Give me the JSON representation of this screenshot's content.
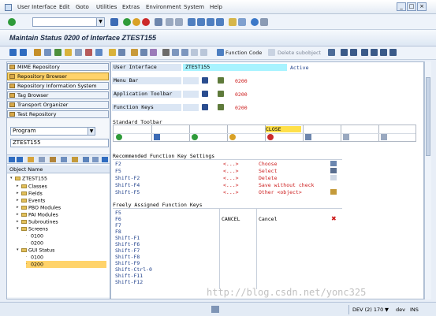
{
  "menu": {
    "items": [
      "User Interface",
      "Edit",
      "Goto",
      "Utilities",
      "Extras",
      "Environment",
      "System",
      "Help"
    ]
  },
  "title": "Maintain Status 0200 of Interface ZTEST155",
  "toolbar2": {
    "function_code": "Function Code",
    "delete_subobject": "Delete subobject"
  },
  "nav": {
    "buttons": [
      "MIME Repository",
      "Repository Browser",
      "Repository Information System",
      "Tag Browser",
      "Transport Organizer",
      "Test Repository"
    ],
    "selected_index": 1
  },
  "object": {
    "type": "Program",
    "name": "ZTEST155"
  },
  "tree": {
    "header": "Object Name",
    "nodes": [
      {
        "label": "ZTEST155",
        "depth": 0,
        "expanded": true
      },
      {
        "label": "Classes",
        "depth": 1
      },
      {
        "label": "Fields",
        "depth": 1
      },
      {
        "label": "Events",
        "depth": 1
      },
      {
        "label": "PBO Modules",
        "depth": 1
      },
      {
        "label": "PAI Modules",
        "depth": 1
      },
      {
        "label": "Subroutines",
        "depth": 1
      },
      {
        "label": "Screens",
        "depth": 1,
        "expanded": true
      },
      {
        "label": "0100",
        "depth": 2
      },
      {
        "label": "0200",
        "depth": 2
      },
      {
        "label": "GUI Status",
        "depth": 1,
        "expanded": true
      },
      {
        "label": "0100",
        "depth": 2
      },
      {
        "label": "0200",
        "depth": 2,
        "selected": true
      }
    ]
  },
  "header_fields": {
    "user_interface_label": "User Interface",
    "user_interface_value": "ZTEST155",
    "status": "Active",
    "menu_bar_label": "Menu Bar",
    "menu_bar_value": "0200",
    "app_toolbar_label": "Application Toolbar",
    "app_toolbar_value": "0200",
    "function_keys_label": "Function Keys",
    "function_keys_value": "0200"
  },
  "standard_toolbar": {
    "title": "Standard Toolbar",
    "close_code": "CLOSE"
  },
  "recommended": {
    "title": "Recommended Function Key Settings",
    "rows": [
      {
        "key": "F2",
        "code": "<...>",
        "text": "Choose"
      },
      {
        "key": "F5",
        "code": "<...>",
        "text": "Select"
      },
      {
        "key": "Shift-F2",
        "code": "<...>",
        "text": "Delete"
      },
      {
        "key": "Shift-F4",
        "code": "<...>",
        "text": "Save without check"
      },
      {
        "key": "Shift-F5",
        "code": "<...>",
        "text": "Other <object>"
      }
    ]
  },
  "freely": {
    "title": "Freely Assigned Function Keys",
    "rows": [
      {
        "key": "F6",
        "code": "CANCEL",
        "text": "Cancel"
      },
      {
        "key": "F7",
        "code": "",
        "text": ""
      },
      {
        "key": "F8",
        "code": "",
        "text": ""
      },
      {
        "key": "Shift-F1",
        "code": "",
        "text": ""
      },
      {
        "key": "Shift-F6",
        "code": "",
        "text": ""
      },
      {
        "key": "Shift-F7",
        "code": "",
        "text": ""
      },
      {
        "key": "Shift-F8",
        "code": "",
        "text": ""
      },
      {
        "key": "Shift-F9",
        "code": "",
        "text": ""
      },
      {
        "key": "Shift-Ctrl-0",
        "code": "",
        "text": ""
      },
      {
        "key": "Shift-F11",
        "code": "",
        "text": ""
      },
      {
        "key": "Shift-F12",
        "code": "",
        "text": ""
      }
    ],
    "first_key": "F5"
  },
  "statusbar": {
    "system": "DEV (2) 170",
    "host": "dev",
    "mode": "INS"
  },
  "watermark": "http://blog.csdn.net/yonc325"
}
